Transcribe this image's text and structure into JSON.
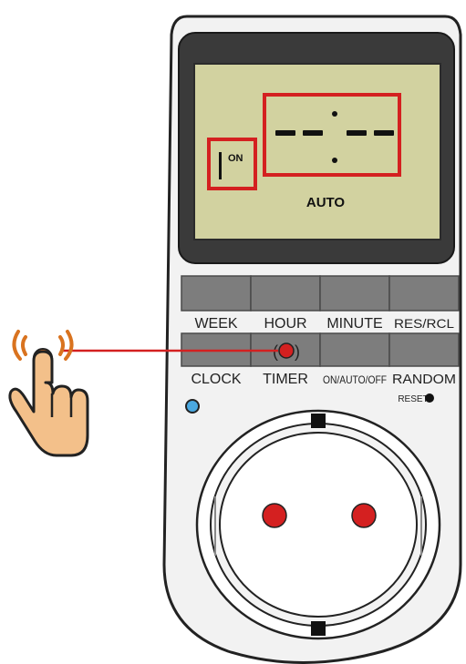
{
  "lcd": {
    "time_digits": "- - : - -",
    "on_label": "ON",
    "mode_label": "AUTO"
  },
  "buttons_top": [
    {
      "label": "WEEK"
    },
    {
      "label": "HOUR"
    },
    {
      "label": "MINUTE"
    },
    {
      "label": "RES/RCL"
    }
  ],
  "buttons_bottom": [
    {
      "label": "CLOCK"
    },
    {
      "label": "TIMER"
    },
    {
      "label": "ON/AUTO/OFF"
    },
    {
      "label": "RANDOM"
    }
  ],
  "reset_label": "RESET",
  "icons": {
    "pointer": "pointing-hand-icon",
    "press_indicator": "press-target-icon"
  },
  "colors": {
    "lcd_background": "#d2d2a0",
    "highlight": "#d42020",
    "button": "#7d7d7d",
    "hand": "#f3c08a",
    "led": "#4aa8e0"
  }
}
